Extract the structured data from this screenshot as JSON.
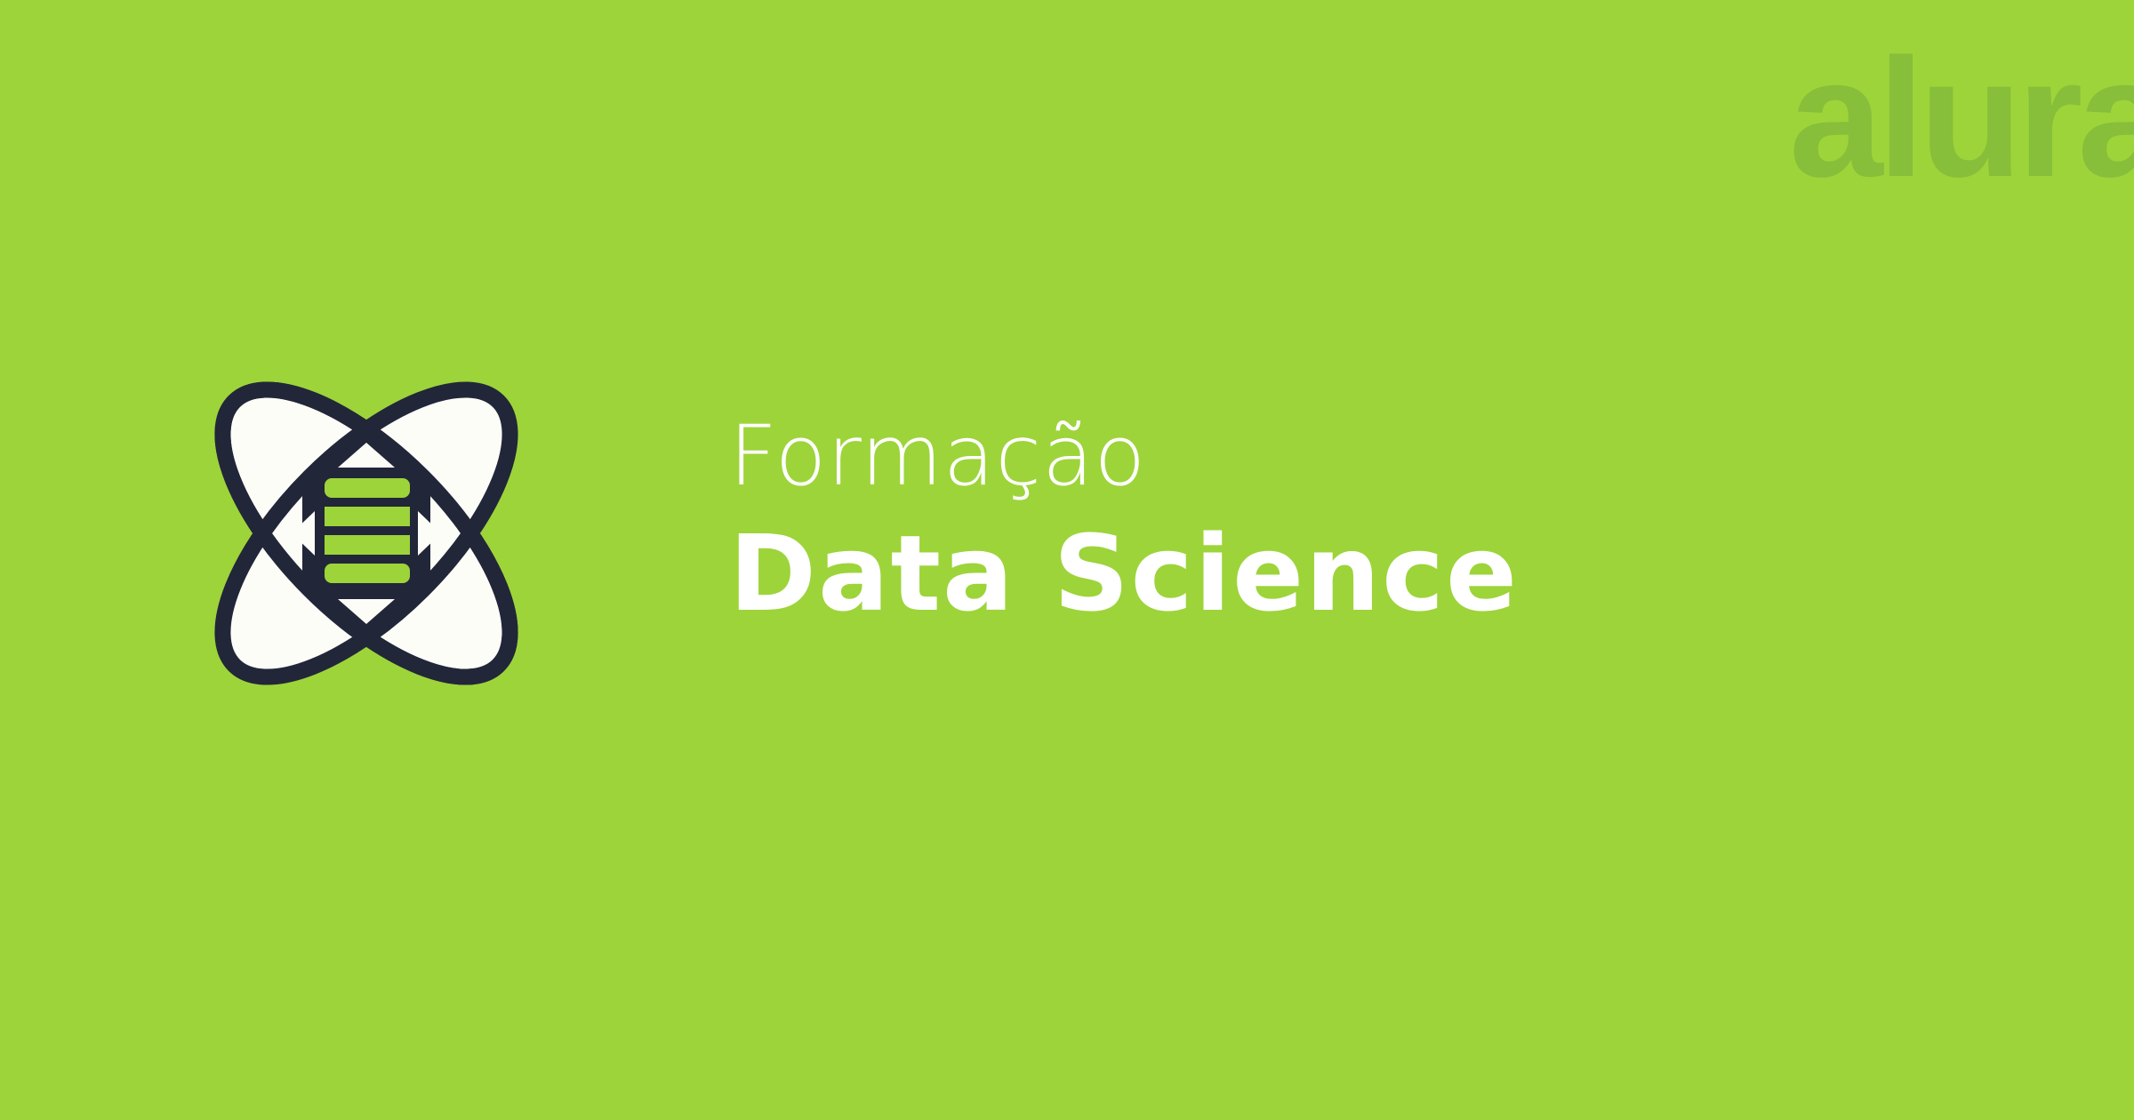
{
  "brand": {
    "logo_text": "alura",
    "logo_color": "#85bc3a"
  },
  "background_color": "#9dd43a",
  "icon": {
    "name": "data-science-atom-icon",
    "outline_color": "#222639",
    "fill_color": "#fdfdf8",
    "accent_color": "#9dd43a"
  },
  "content": {
    "eyebrow": "Formação",
    "title": "Data Science"
  }
}
